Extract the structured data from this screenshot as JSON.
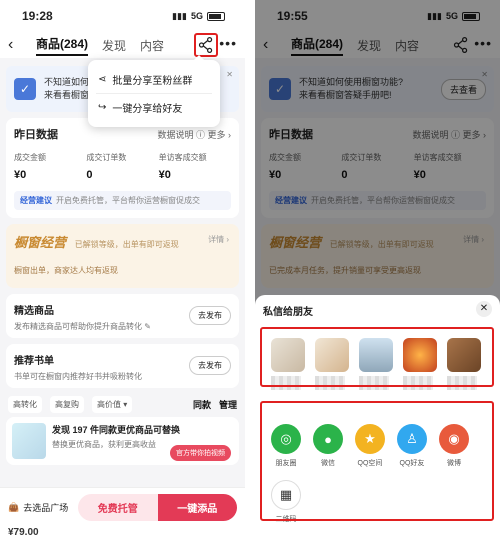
{
  "left": {
    "status": {
      "time": "19:28",
      "network": "5G"
    },
    "nav": {
      "tabs": [
        "商品(284)",
        "发现",
        "内容"
      ]
    },
    "popup": {
      "items": [
        "批量分享至粉丝群",
        "一键分享给好友"
      ]
    },
    "banner": {
      "line1": "不知道如何",
      "line2": "来看看橱窗"
    },
    "data": {
      "title": "昨日数据",
      "links": "数据说明 ⓘ  更多 ›",
      "metrics": [
        {
          "label": "成交金额",
          "value": "¥0"
        },
        {
          "label": "成交订单数",
          "value": "0"
        },
        {
          "label": "单访客成交额",
          "value": "¥0"
        }
      ],
      "tip_label": "经营建议",
      "tip_text": "开启免费托管，平台帮你运营橱窗促成交"
    },
    "gold": {
      "title": "橱窗经营",
      "subtitle": "已解锁等级，出单有即可返现",
      "detail": "详情 ›",
      "line2": "橱窗出单，商家达人均有返现"
    },
    "select": {
      "title": "精选商品",
      "sub": "发布精选商品可帮助你提升商品转化 ✎",
      "btn": "去发布"
    },
    "books": {
      "title": "推荐书单",
      "sub": "书单可在橱窗内推荐好书并吸粉转化",
      "btn": "去发布"
    },
    "filters": [
      "高转化",
      "高复购",
      "高价值 ▾"
    ],
    "filters_right": [
      "同款",
      "管理"
    ],
    "promo": {
      "title": "发现 197 件同款更优商品可替换",
      "sub": "替换更优商品，获利更高收益",
      "tag": "官方带你拍视频"
    },
    "bottom": {
      "store": "去选品广场",
      "b1": "免费托管",
      "b2": "一键添品",
      "price": "¥79.00"
    }
  },
  "right": {
    "status": {
      "time": "19:55",
      "network": "5G"
    },
    "nav": {
      "tabs": [
        "商品(284)",
        "发现",
        "内容"
      ]
    },
    "banner": {
      "line1": "不知道如何使用橱窗功能?",
      "line2": "来看看橱窗答疑手册吧!",
      "btn": "去查看"
    },
    "data": {
      "title": "昨日数据",
      "links": "数据说明 ⓘ  更多 ›",
      "metrics": [
        {
          "label": "成交金额",
          "value": "¥0"
        },
        {
          "label": "成交订单数",
          "value": "0"
        },
        {
          "label": "单访客成交额",
          "value": "¥0"
        }
      ],
      "tip_label": "经营建议",
      "tip_text": "开启免费托管，平台帮你运营橱窗促成交"
    },
    "gold": {
      "title": "橱窗经营",
      "subtitle": "已解锁等级，出单有即可返现",
      "detail": "详情 ›",
      "line2": "已完成本月任务，提升销量可享受更高返现"
    },
    "sheet": {
      "title": "私信给朋友",
      "apps": [
        {
          "name": "朋友圈",
          "color": "#2bb34a",
          "icon": "moments-icon"
        },
        {
          "name": "微信",
          "color": "#2bb34a",
          "icon": "wechat-icon"
        },
        {
          "name": "QQ空间",
          "color": "#f3b321",
          "icon": "qzone-icon"
        },
        {
          "name": "QQ好友",
          "color": "#31a8ef",
          "icon": "qq-icon"
        },
        {
          "name": "微博",
          "color": "#e85a3c",
          "icon": "weibo-icon"
        },
        {
          "name": "二维码",
          "color": "#ffffff",
          "icon": "qrcode-icon"
        }
      ]
    }
  }
}
